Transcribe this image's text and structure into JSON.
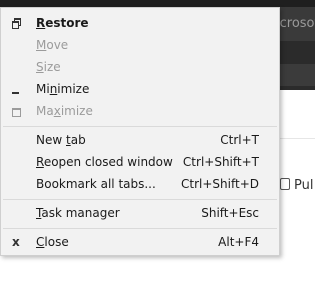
{
  "background": {
    "tab_title": "icrosot",
    "toolbar_button_label": "Pul"
  },
  "menu": {
    "items": [
      {
        "name": "restore",
        "pre": "",
        "mnemonic": "R",
        "post": "estore",
        "accel": "",
        "enabled": true,
        "bold": true,
        "icon": "restore-icon"
      },
      {
        "name": "move",
        "pre": "",
        "mnemonic": "M",
        "post": "ove",
        "accel": "",
        "enabled": false,
        "bold": false,
        "icon": ""
      },
      {
        "name": "size",
        "pre": "",
        "mnemonic": "S",
        "post": "ize",
        "accel": "",
        "enabled": false,
        "bold": false,
        "icon": ""
      },
      {
        "name": "minimize",
        "pre": "Mi",
        "mnemonic": "n",
        "post": "imize",
        "accel": "",
        "enabled": true,
        "bold": false,
        "icon": "minimize-icon"
      },
      {
        "name": "maximize",
        "pre": "Ma",
        "mnemonic": "x",
        "post": "imize",
        "accel": "",
        "enabled": false,
        "bold": false,
        "icon": "maximize-icon"
      },
      {
        "name": "new-tab",
        "pre": "New ",
        "mnemonic": "t",
        "post": "ab",
        "accel": "Ctrl+T",
        "enabled": true,
        "bold": false,
        "icon": ""
      },
      {
        "name": "reopen-closed-window",
        "pre": "",
        "mnemonic": "R",
        "post": "eopen closed window",
        "accel": "Ctrl+Shift+T",
        "enabled": true,
        "bold": false,
        "icon": ""
      },
      {
        "name": "bookmark-all-tabs",
        "pre": "Bookmark all tabs...",
        "mnemonic": "",
        "post": "",
        "accel": "Ctrl+Shift+D",
        "enabled": true,
        "bold": false,
        "icon": ""
      },
      {
        "name": "task-manager",
        "pre": "",
        "mnemonic": "T",
        "post": "ask manager",
        "accel": "Shift+Esc",
        "enabled": true,
        "bold": false,
        "icon": ""
      },
      {
        "name": "close",
        "pre": "",
        "mnemonic": "C",
        "post": "lose",
        "accel": "Alt+F4",
        "enabled": true,
        "bold": false,
        "icon": "close-icon"
      }
    ],
    "close_glyph": "x"
  }
}
